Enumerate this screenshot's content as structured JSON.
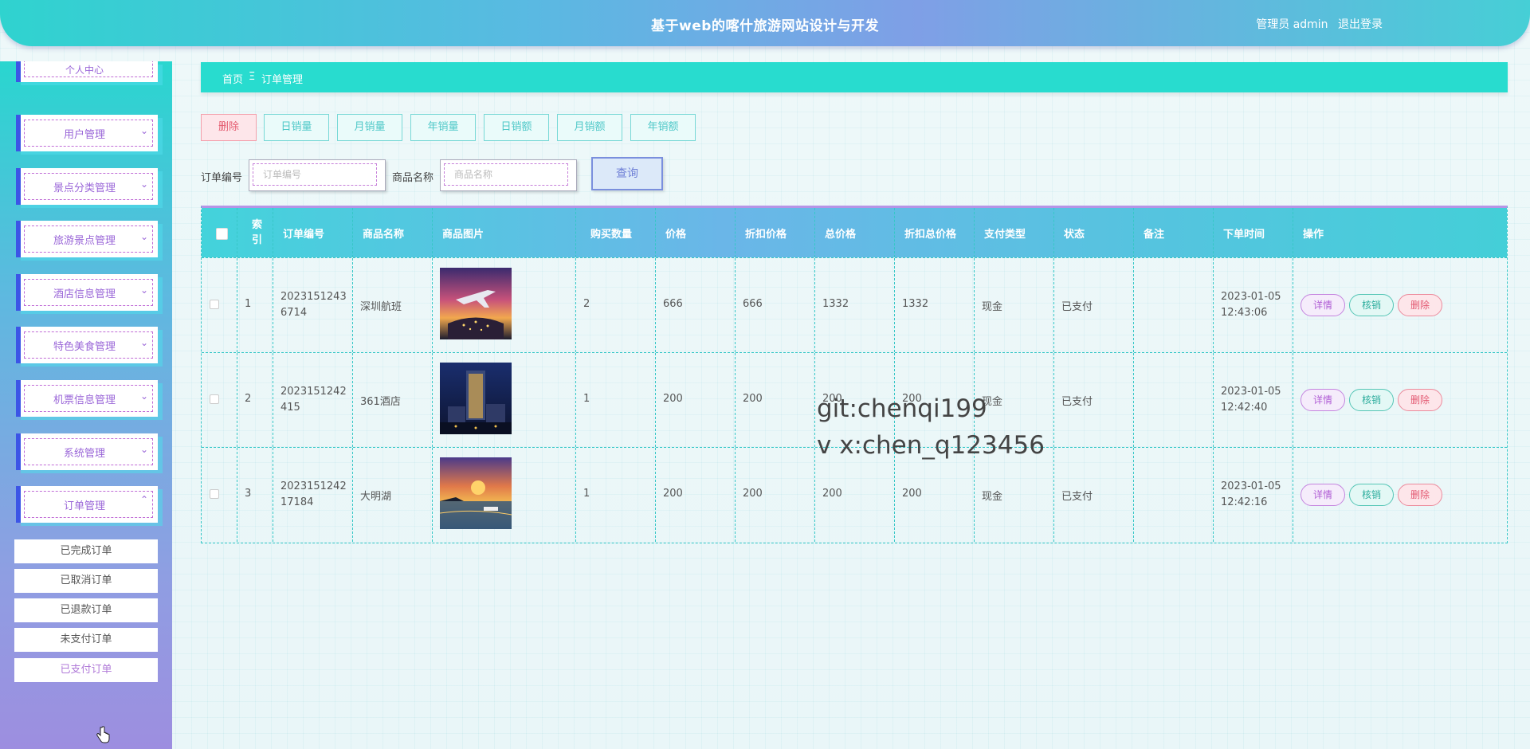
{
  "header": {
    "title": "基于web的喀什旅游网站设计与开发",
    "user_label": "管理员 admin",
    "logout_label": "退出登录"
  },
  "sidebar": {
    "partial_label": "个人中心",
    "items": [
      {
        "label": "用户管理"
      },
      {
        "label": "景点分类管理"
      },
      {
        "label": "旅游景点管理"
      },
      {
        "label": "酒店信息管理"
      },
      {
        "label": "特色美食管理"
      },
      {
        "label": "机票信息管理"
      },
      {
        "label": "系统管理"
      },
      {
        "label": "订单管理"
      }
    ],
    "sub_items": [
      {
        "label": "已完成订单"
      },
      {
        "label": "已取消订单"
      },
      {
        "label": "已退款订单"
      },
      {
        "label": "未支付订单"
      },
      {
        "label": "已支付订单"
      }
    ]
  },
  "breadcrumb": {
    "home": "首页",
    "sep": "Ξ",
    "current": "订单管理"
  },
  "toolbar": {
    "delete": "删除",
    "daily_sales": "日销量",
    "monthly_sales": "月销量",
    "yearly_sales": "年销量",
    "daily_revenue": "日销额",
    "monthly_revenue": "月销额",
    "yearly_revenue": "年销额"
  },
  "search": {
    "order_label": "订单编号",
    "order_placeholder": "订单编号",
    "product_label": "商品名称",
    "product_placeholder": "商品名称",
    "query": "查询"
  },
  "table": {
    "headers": [
      "索引",
      "订单编号",
      "商品名称",
      "商品图片",
      "购买数量",
      "价格",
      "折扣价格",
      "总价格",
      "折扣总价格",
      "支付类型",
      "状态",
      "备注",
      "下单时间",
      "操作"
    ],
    "header_index": "索\n引",
    "rows": [
      {
        "index": "1",
        "order_no_1": "2023151243",
        "order_no_2": "6714",
        "name": "深圳航班",
        "qty": "2",
        "price": "666",
        "discount_price": "666",
        "total": "1332",
        "discount_total": "1332",
        "pay_type": "现金",
        "status": "已支付",
        "note": "",
        "date": "2023-01-05",
        "time": "12:43:06"
      },
      {
        "index": "2",
        "order_no_1": "2023151242",
        "order_no_2": "415",
        "name": "361酒店",
        "qty": "1",
        "price": "200",
        "discount_price": "200",
        "total": "200",
        "discount_total": "200",
        "pay_type": "现金",
        "status": "已支付",
        "note": "",
        "date": "2023-01-05",
        "time": "12:42:40"
      },
      {
        "index": "3",
        "order_no_1": "2023151242",
        "order_no_2": "17184",
        "name": "大明湖",
        "qty": "1",
        "price": "200",
        "discount_price": "200",
        "total": "200",
        "discount_total": "200",
        "pay_type": "现金",
        "status": "已支付",
        "note": "",
        "date": "2023-01-05",
        "time": "12:42:16"
      }
    ],
    "actions": {
      "detail": "详情",
      "verify": "核销",
      "delete": "删除"
    }
  },
  "watermark": {
    "line1": "git:chenqi199",
    "line2": "v x:chen_q123456"
  }
}
